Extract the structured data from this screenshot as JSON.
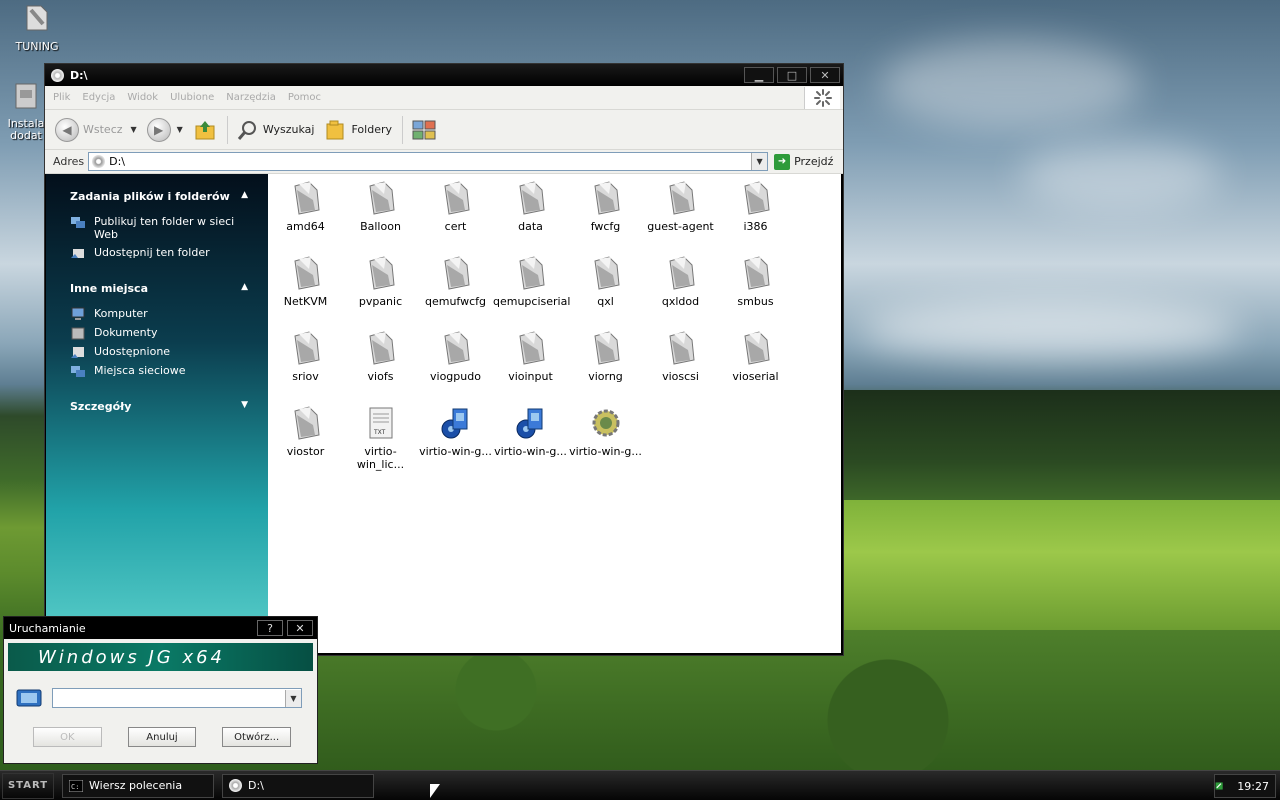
{
  "desktop": {
    "icons": [
      {
        "label": "TUNING",
        "icon": "tuning-icon"
      },
      {
        "label": "Instala dodat",
        "icon": "installer-icon"
      }
    ]
  },
  "explorer": {
    "title": "D:\\",
    "menu": [
      "Plik",
      "Edycja",
      "Widok",
      "Ulubione",
      "Narzędzia",
      "Pomoc"
    ],
    "toolbar": {
      "back": "Wstecz",
      "search": "Wyszukaj",
      "folders": "Foldery"
    },
    "address": {
      "label": "Adres",
      "value": "D:\\",
      "go": "Przejdź"
    },
    "sidebar": {
      "tasks": {
        "title": "Zadania plików i folderów",
        "items": [
          "Publikuj ten folder w sieci Web",
          "Udostępnij ten folder"
        ]
      },
      "places": {
        "title": "Inne miejsca",
        "items": [
          "Komputer",
          "Dokumenty",
          "Udostępnione",
          "Miejsca sieciowe"
        ]
      },
      "details": {
        "title": "Szczegóły"
      }
    },
    "files": [
      {
        "name": "amd64",
        "type": "folder"
      },
      {
        "name": "Balloon",
        "type": "folder"
      },
      {
        "name": "cert",
        "type": "folder"
      },
      {
        "name": "data",
        "type": "folder"
      },
      {
        "name": "fwcfg",
        "type": "folder"
      },
      {
        "name": "guest-agent",
        "type": "folder"
      },
      {
        "name": "i386",
        "type": "folder"
      },
      {
        "name": "NetKVM",
        "type": "folder"
      },
      {
        "name": "pvpanic",
        "type": "folder"
      },
      {
        "name": "qemufwcfg",
        "type": "folder"
      },
      {
        "name": "qemupciserial",
        "type": "folder"
      },
      {
        "name": "qxl",
        "type": "folder"
      },
      {
        "name": "qxldod",
        "type": "folder"
      },
      {
        "name": "smbus",
        "type": "folder"
      },
      {
        "name": "sriov",
        "type": "folder"
      },
      {
        "name": "viofs",
        "type": "folder"
      },
      {
        "name": "viogpudo",
        "type": "folder"
      },
      {
        "name": "vioinput",
        "type": "folder"
      },
      {
        "name": "viorng",
        "type": "folder"
      },
      {
        "name": "vioscsi",
        "type": "folder"
      },
      {
        "name": "vioserial",
        "type": "folder"
      },
      {
        "name": "viostor",
        "type": "folder"
      },
      {
        "name": "virtio-win_lic...",
        "type": "txt"
      },
      {
        "name": "virtio-win-g...",
        "type": "msi"
      },
      {
        "name": "virtio-win-g...",
        "type": "msi"
      },
      {
        "name": "virtio-win-g...",
        "type": "exe"
      }
    ]
  },
  "run_dialog": {
    "title": "Uruchamianie",
    "help": "?",
    "close": "✕",
    "banner": "Windows JG x64",
    "buttons": {
      "ok": "OK",
      "cancel": "Anuluj",
      "browse": "Otwórz..."
    }
  },
  "taskbar": {
    "start": "START",
    "tasks": [
      "Wiersz polecenia",
      "D:\\"
    ],
    "clock": "19:27"
  }
}
